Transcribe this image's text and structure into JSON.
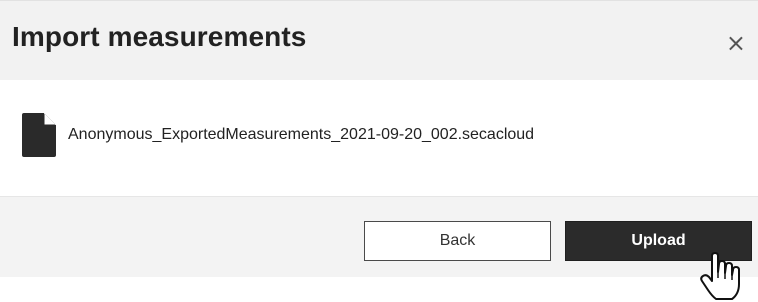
{
  "dialog": {
    "title": "Import measurements",
    "close_symbol": "×",
    "file": {
      "icon": "document-icon",
      "name": "Anonymous_ExportedMeasurements_2021-09-20_002.secacloud"
    },
    "buttons": {
      "back_label": "Back",
      "upload_label": "Upload"
    }
  },
  "colors": {
    "header_bg": "#f2f2f2",
    "body_bg": "#ffffff",
    "primary_button": "#2b2b2b",
    "text": "#222222"
  },
  "cursor": {
    "icon": "hand-pointer-icon"
  }
}
